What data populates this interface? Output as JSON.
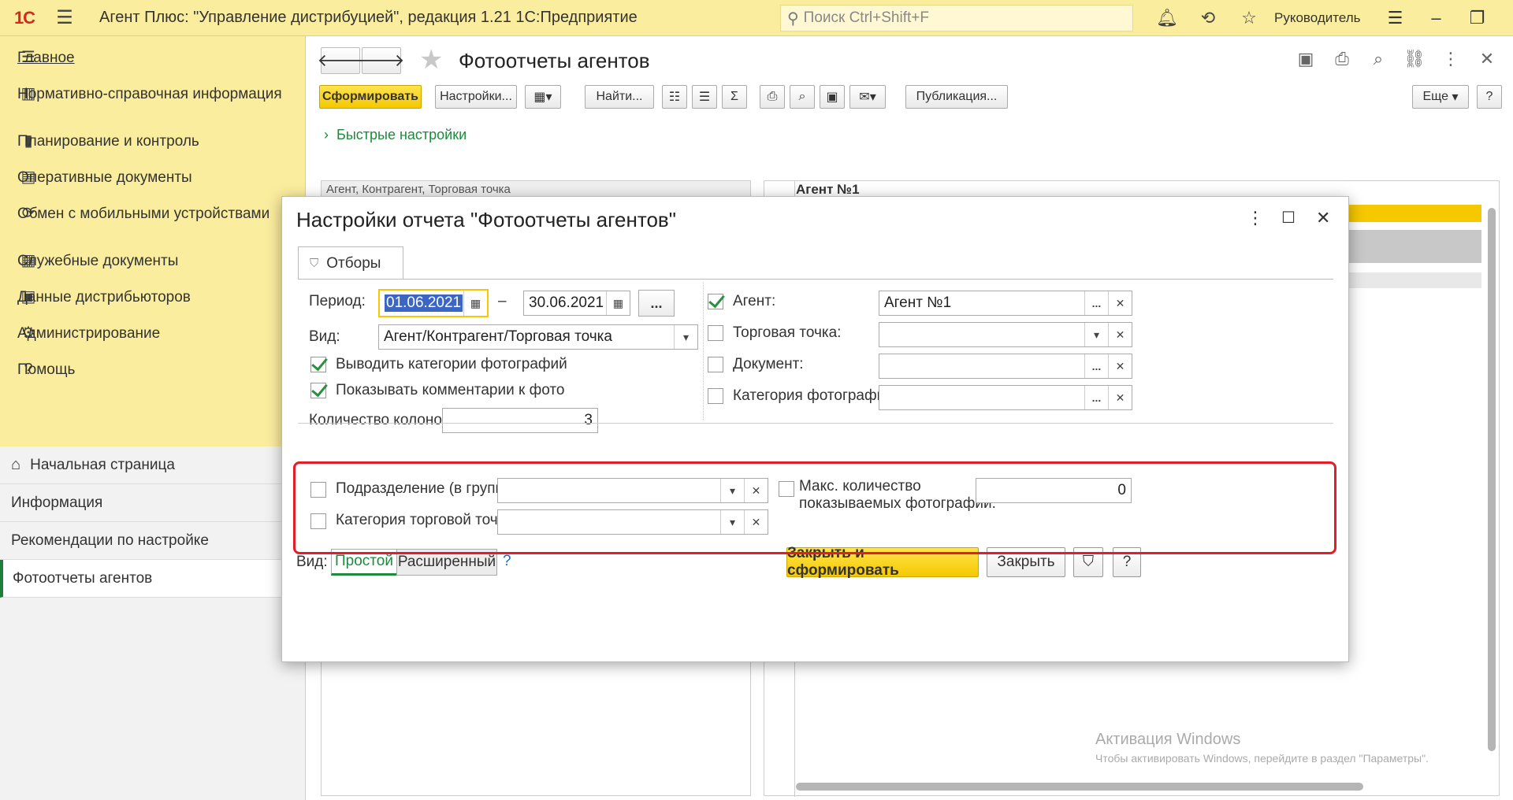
{
  "titlebar": {
    "logo": "1С",
    "title": "Агент Плюс: \"Управление дистрибуцией\", редакция 1.21 1С:Предприятие",
    "search_placeholder": "Поиск Ctrl+Shift+F",
    "user": "Руководитель"
  },
  "sidebar": {
    "items": [
      {
        "label": "Главное",
        "icon": "menu-icon"
      },
      {
        "label": "Нормативно-справочная информация",
        "icon": "books-icon"
      },
      {
        "label": "Планирование и контроль",
        "icon": "bar-chart-icon"
      },
      {
        "label": "Оперативные документы",
        "icon": "documents-icon"
      },
      {
        "label": "Обмен с мобильными устройствами",
        "icon": "sync-icon"
      },
      {
        "label": "Служебные документы",
        "icon": "service-docs-icon"
      },
      {
        "label": "Данные дистрибьюторов",
        "icon": "database-icon"
      },
      {
        "label": "Администрирование",
        "icon": "gear-icon"
      },
      {
        "label": "Помощь",
        "icon": "help-icon"
      }
    ],
    "lower": [
      {
        "label": "Начальная страница"
      },
      {
        "label": "Информация"
      },
      {
        "label": "Рекомендации по настройке"
      },
      {
        "label": "Фотоотчеты агентов"
      }
    ]
  },
  "main": {
    "title": "Фотоотчеты агентов",
    "toolbar": {
      "generate": "Сформировать",
      "settings": "Настройки...",
      "find": "Найти...",
      "publish": "Публикация...",
      "more": "Еще",
      "help": "?"
    },
    "quick_settings": "Быстрые настройки",
    "grid_left_header": "Агент, Контрагент, Торговая точка",
    "grid_right_header": "Агент №1"
  },
  "dialog": {
    "title": "Настройки отчета \"Фотоотчеты агентов\"",
    "tab": "Отборы",
    "period_label": "Период:",
    "period_from": "01.06.2021",
    "period_dash": "–",
    "period_to": "30.06.2021",
    "period_more": "...",
    "view_label": "Вид:",
    "view_value": "Агент/Контрагент/Торговая точка",
    "show_categories": "Выводить категории фотографий",
    "show_comments": "Показывать комментарии к фото",
    "columns_label": "Количество колонок:",
    "columns_value": "3",
    "agent_label": "Агент:",
    "agent_value": "Агент №1",
    "outlet_label": "Торговая точка:",
    "document_label": "Документ:",
    "photo_category_label": "Категория фотографий:",
    "subdivision_label": "Подразделение (в группе):",
    "outlet_category_label": "Категория торговой точки:",
    "max_photos_label_1": "Макс. количество",
    "max_photos_label_2": "показываемых фотографий:",
    "max_photos_value": "0",
    "mode_label": "Вид:",
    "mode_simple": "Простой",
    "mode_advanced": "Расширенный",
    "mode_help": "?",
    "close_generate": "Закрыть и сформировать",
    "close": "Закрыть",
    "help": "?"
  },
  "watermark": {
    "line1": "Активация Windows",
    "line2": "Чтобы активировать Windows, перейдите в раздел \"Параметры\"."
  },
  "colors": {
    "accent_yellow": "#f5c800",
    "header_yellow": "#fbed9e",
    "green": "#1e8a3c",
    "highlight_red": "#e31d2a"
  }
}
